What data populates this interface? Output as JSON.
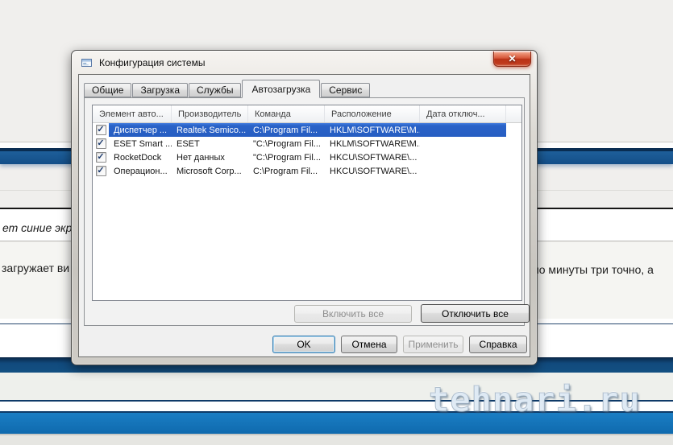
{
  "page": {
    "watermark": "tehnari.ru",
    "text_fragments": {
      "quote_italic": "ет синие экр",
      "para_left": "загружает ви",
      "para_right": "но минуты три точно, а"
    },
    "colors": {
      "divider_blue": "#134e88",
      "navy_band": "#114a7d",
      "bright_blue_band": "#0f6aae",
      "page_bg": "#f0efed"
    }
  },
  "icons": {
    "check": "✓",
    "close": "✕"
  },
  "dialog": {
    "title": "Конфигурация системы",
    "tabs": [
      {
        "label": "Общие"
      },
      {
        "label": "Загрузка"
      },
      {
        "label": "Службы"
      },
      {
        "label": "Автозагрузка"
      },
      {
        "label": "Сервис"
      }
    ],
    "table": {
      "columns": [
        "Элемент авто...",
        "Производитель",
        "Команда",
        "Расположение",
        "Дата отключ..."
      ],
      "rows": [
        {
          "checked": true,
          "selected": true,
          "name": "Диспетчер ...",
          "manufacturer": "Realtek Semico...",
          "command": "C:\\Program Fil...",
          "location": "HKLM\\SOFTWARE\\M...",
          "date": ""
        },
        {
          "checked": true,
          "selected": false,
          "name": "ESET Smart ...",
          "manufacturer": "ESET",
          "command": "\"C:\\Program Fil...",
          "location": "HKLM\\SOFTWARE\\M...",
          "date": ""
        },
        {
          "checked": true,
          "selected": false,
          "name": "RocketDock",
          "manufacturer": "Нет данных",
          "command": "\"C:\\Program Fil...",
          "location": "HKCU\\SOFTWARE\\...",
          "date": ""
        },
        {
          "checked": true,
          "selected": false,
          "name": "Операцион...",
          "manufacturer": "Microsoft Corp...",
          "command": "C:\\Program Fil...",
          "location": "HKCU\\SOFTWARE\\...",
          "date": ""
        }
      ]
    },
    "buttons": {
      "enable_all": {
        "label": "Включить все",
        "disabled": true
      },
      "disable_all": {
        "label": "Отключить все",
        "disabled": false
      },
      "ok": "OK",
      "cancel": "Отмена",
      "apply": {
        "label": "Применить",
        "disabled": true
      },
      "help": "Справка"
    },
    "selection_color": "#2a63c8"
  }
}
